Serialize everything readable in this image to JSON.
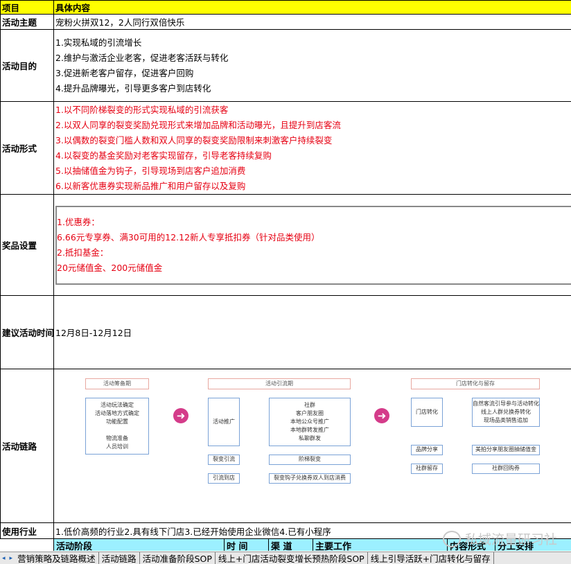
{
  "header": {
    "col1": "项目",
    "col2": "具体内容"
  },
  "theme": {
    "label": "活动主题",
    "value": "宠粉火拼双12，2人同行双倍快乐"
  },
  "purpose": {
    "label": "活动目的",
    "items": [
      "1.实现私域的引流增长",
      "2.维护与激活企业老客，促进老客活跃与转化",
      "3.促进新老客户留存，促进客户回购",
      "4.提升品牌曝光，引导更多客户到店转化"
    ]
  },
  "form": {
    "label": "活动形式",
    "items": [
      "1.以不同阶梯裂变的形式实现私域的引流获客",
      "2.以双人同享的裂变奖励兑现形式来增加品牌和活动曝光，且提升到店客流",
      "3.以偶数的裂变门槛人数和双人同享的裂变奖励限制来刺激客户持续裂变",
      "4.以裂变的基金奖励对老客实现留存，引导老客持续复购",
      "5.以抽储值金为钩子，引导现场到店客户追加消费",
      "6.以新客优惠券实现新品推广和用户留存以及复购"
    ]
  },
  "prizes": {
    "label": "奖品设置",
    "items": [
      "1.优惠券：",
      "6.66元专享券、满30可用的12.12新人专享抵扣券（针对品类使用）",
      "2.抵扣基金：",
      "20元储值金、200元储值金"
    ]
  },
  "time": {
    "label": "建议活动时间",
    "value": "12月8日-12月12日"
  },
  "chain": {
    "label": "活动链路",
    "phase1": {
      "title": "活动筹备期",
      "box": [
        "活动玩法确定",
        "活动落地方式确定",
        "功能配置",
        "",
        "物流准备",
        "人员培训"
      ]
    },
    "phase2": {
      "title": "活动引流期",
      "promo": "活动推广",
      "channels": [
        "社群",
        "客户朋友圈",
        "本地公众号推广",
        "本地群转发推广",
        "私聊群发"
      ],
      "fission_a": "裂变引流",
      "fission_b": "阶梯裂变",
      "store_a": "引流到店",
      "store_b": "裂变钩子兑换券双人到店消费"
    },
    "phase3": {
      "title": "门店转化与留存",
      "conv": "门店转化",
      "conv_items": [
        "自然客流引导参与活动转化",
        "线上人群兑换券转化",
        "现场品类销售追加"
      ],
      "brand": "品牌分享",
      "brand_item": "美拍分享朋友圈抽储值金",
      "retain": "社群留存",
      "retain_item": "社群回购券"
    }
  },
  "industry": {
    "label": "使用行业",
    "value": "1.低价高频的行业2.具有线下门店3.已经开始使用企业微信4.已有小程序"
  },
  "bottom": {
    "stage": "活动阶段",
    "time": "时  间",
    "channel": "渠  道",
    "work": "主要工作",
    "form": "内容形式",
    "division": "分工安排"
  },
  "watermark": "私域流量研习社",
  "tabs": [
    "营销策略及链路概述",
    "活动链路",
    "活动准备阶段SOP",
    "线上+门店活动裂变增长预热阶段SOP",
    "线上引导活跃+门店转化与留存"
  ],
  "tabnav": {
    "prev": "◂",
    "next": "▸"
  }
}
